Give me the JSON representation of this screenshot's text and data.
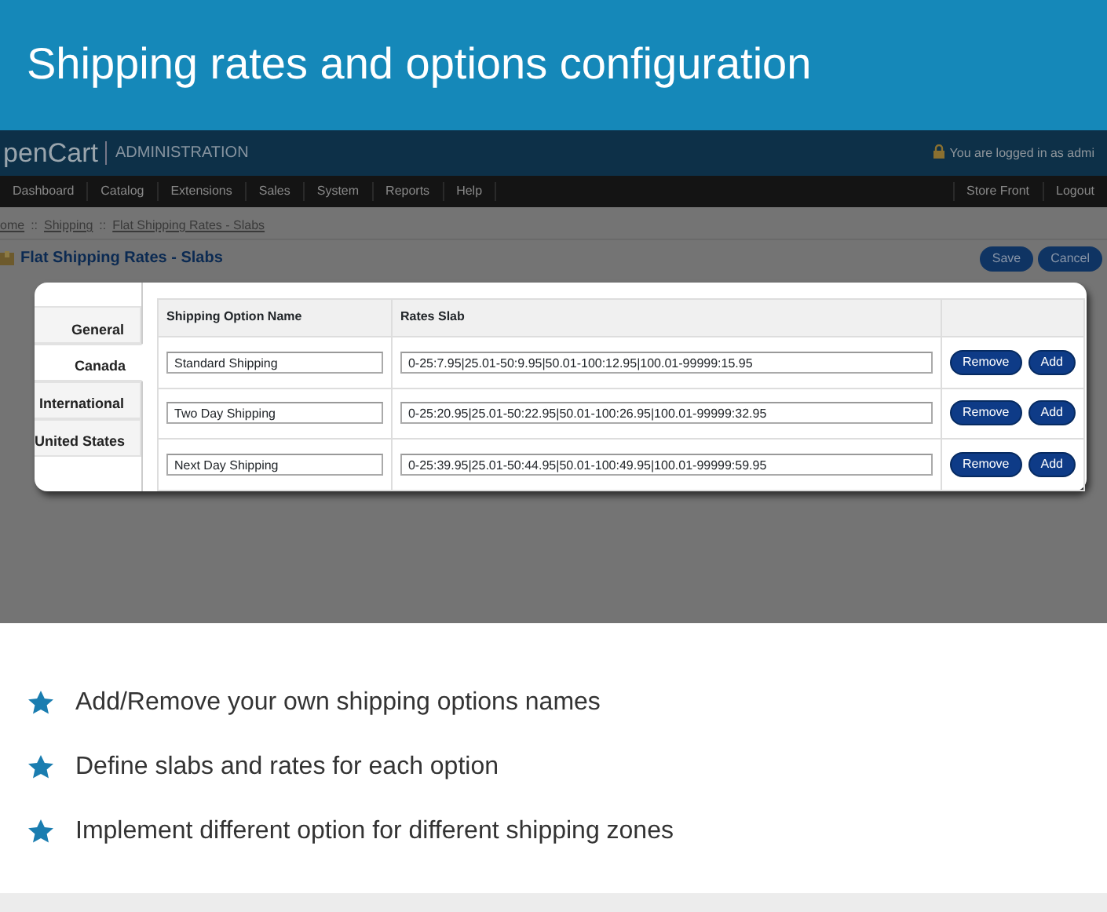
{
  "banner": {
    "title": "Shipping rates and options configuration"
  },
  "admin_header": {
    "brand": "penCart",
    "section": "ADMINISTRATION",
    "login_text": "You are logged in as admi"
  },
  "nav": {
    "items": [
      "Dashboard",
      "Catalog",
      "Extensions",
      "Sales",
      "System",
      "Reports",
      "Help"
    ],
    "right_items": [
      "Store Front",
      "Logout"
    ]
  },
  "breadcrumb": [
    "ome",
    "Shipping",
    "Flat Shipping Rates - Slabs"
  ],
  "breadcrumb_separator": "::",
  "page": {
    "title": "Flat Shipping Rates - Slabs",
    "buttons": [
      "Save",
      "Cancel"
    ]
  },
  "dialog": {
    "tabs": [
      {
        "label": "General",
        "selected": false
      },
      {
        "label": "Canada",
        "selected": true
      },
      {
        "label": "International",
        "selected": false
      },
      {
        "label": "United States",
        "selected": false
      }
    ],
    "columns": [
      "Shipping Option Name",
      "Rates Slab"
    ],
    "rows": [
      {
        "name": "Standard Shipping",
        "rates": "0-25:7.95|25.01-50:9.95|50.01-100:12.95|100.01-99999:15.95",
        "buttons": [
          "Remove",
          "Add"
        ]
      },
      {
        "name": "Two Day Shipping",
        "rates": "0-25:20.95|25.01-50:22.95|50.01-100:26.95|100.01-99999:32.95",
        "buttons": [
          "Remove",
          "Add"
        ]
      },
      {
        "name": "Next Day Shipping",
        "rates": "0-25:39.95|25.01-50:44.95|50.01-100:49.95|100.01-99999:59.95",
        "buttons": [
          "Remove",
          "Add"
        ]
      }
    ]
  },
  "features": [
    "Add/Remove your own shipping options names",
    "Define slabs and rates for each option",
    "Implement different option for different shipping zones"
  ]
}
